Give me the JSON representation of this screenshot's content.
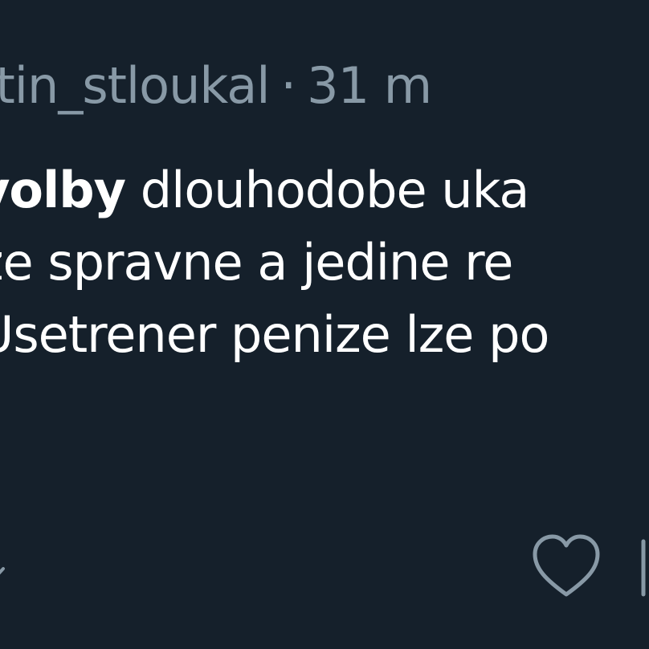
{
  "post": {
    "author_handle": "rtin_stloukal",
    "separator": "·",
    "time_ago": "31 m",
    "lines": [
      {
        "bold": "volby",
        "text": " dlouhodobe uka"
      },
      {
        "bold": "",
        "text": " ze spravne a jedine re"
      },
      {
        "bold": "",
        "text": "Usetrener penize lze po"
      }
    ]
  },
  "actions": {
    "reply_icon": "reply-icon",
    "like_icon": "heart-icon",
    "share_icon": "share-icon"
  },
  "colors": {
    "background": "#15202b",
    "text": "#ffffff",
    "muted": "#8899a6"
  }
}
